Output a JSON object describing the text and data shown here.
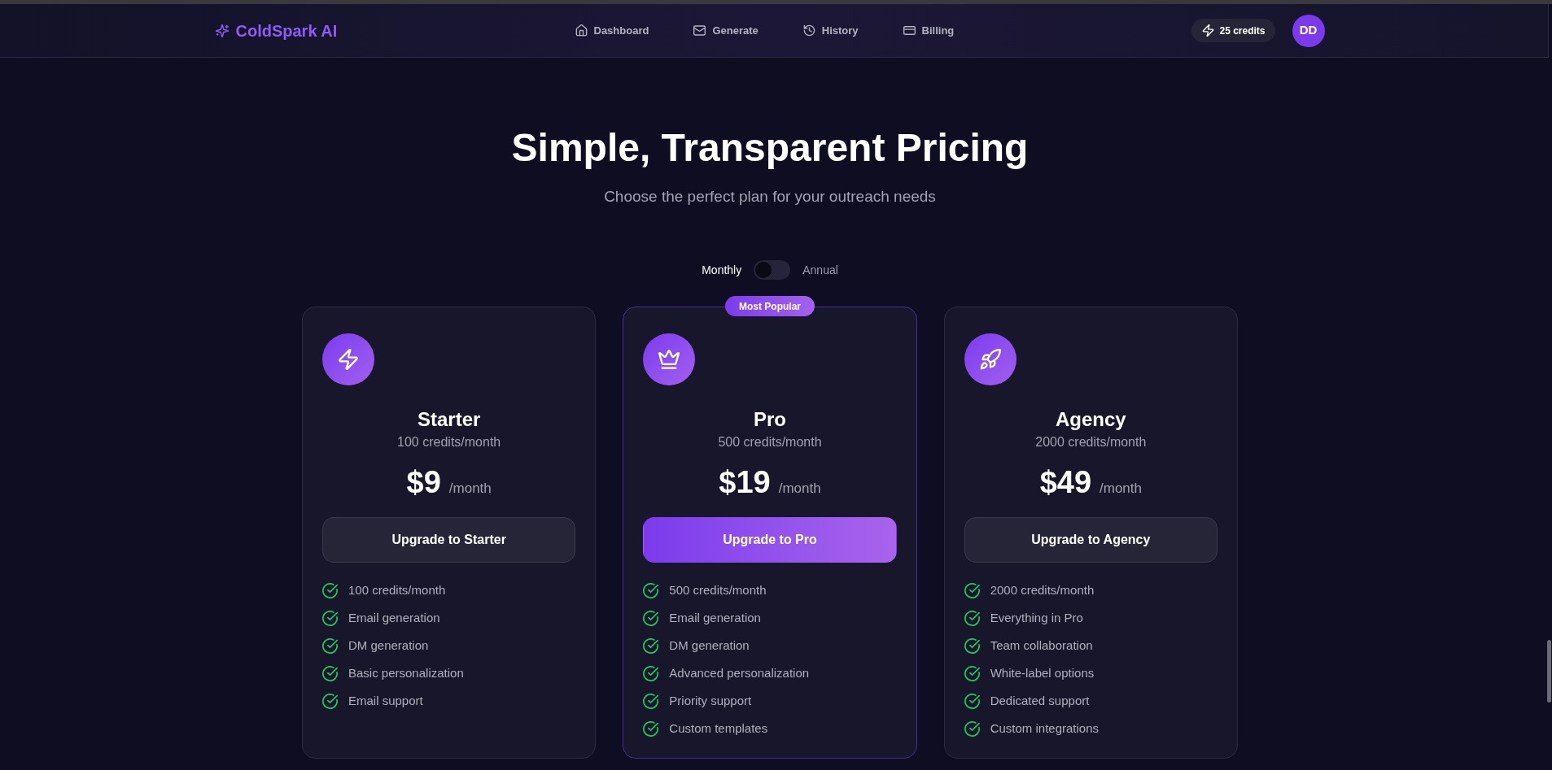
{
  "header": {
    "logo": "ColdSpark AI",
    "nav": [
      {
        "label": "Dashboard",
        "selected": false
      },
      {
        "label": "Generate",
        "selected": false
      },
      {
        "label": "History",
        "selected": false
      },
      {
        "label": "Billing",
        "selected": false
      }
    ],
    "credits": "25 credits",
    "avatar": "DD"
  },
  "hero": {
    "title": "Simple, Transparent Pricing",
    "subtitle": "Choose the perfect plan for your outreach needs"
  },
  "billing_toggle": {
    "monthly": "Monthly",
    "annual": "Annual",
    "annual_on": false
  },
  "plans": [
    {
      "name": "Starter",
      "featured": false,
      "credits": "100 credits/month",
      "price": "$9",
      "period": "/month",
      "button": "Upgrade to Starter",
      "features": [
        "100 credits/month",
        "Email generation",
        "DM generation",
        "Basic personalization",
        "Email support"
      ]
    },
    {
      "name": "Pro",
      "featured": true,
      "badge": "Most Popular",
      "credits": "500 credits/month",
      "price": "$19",
      "period": "/month",
      "button": "Upgrade to Pro",
      "features": [
        "500 credits/month",
        "Email generation",
        "DM generation",
        "Advanced personalization",
        "Priority support",
        "Custom templates"
      ]
    },
    {
      "name": "Agency",
      "featured": false,
      "credits": "2000 credits/month",
      "price": "$49",
      "period": "/month",
      "button": "Upgrade to Agency",
      "features": [
        "2000 credits/month",
        "Everything in Pro",
        "Team collaboration",
        "White-label options",
        "Dedicated support",
        "Custom integrations"
      ]
    }
  ]
}
